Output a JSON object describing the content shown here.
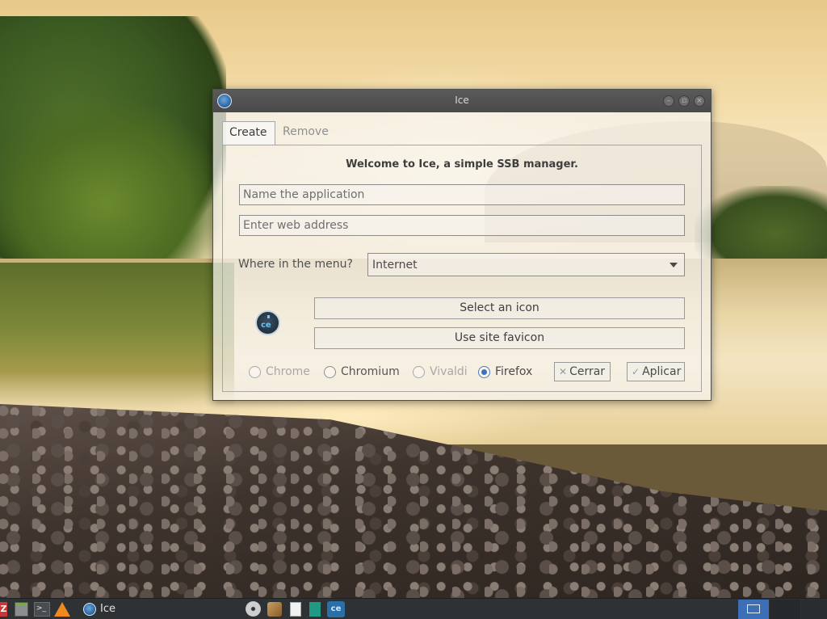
{
  "window": {
    "title": "Ice",
    "tabs": [
      {
        "label": "Create",
        "active": true
      },
      {
        "label": "Remove",
        "active": false
      }
    ],
    "welcome": "Welcome to Ice, a simple SSB manager.",
    "name_field": {
      "value": "",
      "placeholder": "Name the application"
    },
    "url_field": {
      "value": "",
      "placeholder": "Enter web address"
    },
    "menu_label": "Where in the menu?",
    "menu_select": {
      "selected": "Internet"
    },
    "icon_buttons": {
      "select_icon": "Select an icon",
      "favicon": "Use site favicon"
    },
    "browsers": [
      {
        "label": "Chrome",
        "checked": false,
        "enabled": false
      },
      {
        "label": "Chromium",
        "checked": false,
        "enabled": true
      },
      {
        "label": "Vivaldi",
        "checked": false,
        "enabled": false
      },
      {
        "label": "Firefox",
        "checked": true,
        "enabled": true
      }
    ],
    "buttons": {
      "close": "Cerrar",
      "apply": "Aplicar"
    },
    "logo_text": "ce"
  },
  "taskbar": {
    "zotero_glyph": "Z",
    "terminal_glyph": ">_",
    "active_window_label": "Ice",
    "ice_launcher_glyph": "ce",
    "colors": {
      "background": "#2f3234",
      "workspace_active": "#3c6fb8"
    },
    "icons": [
      "zotero-icon",
      "files-icon",
      "terminal-icon",
      "vlc-icon",
      "ice-icon",
      "film-reel-icon",
      "paint-brush-icon",
      "document-icon",
      "book-icon",
      "ice-launcher-icon"
    ]
  },
  "colors": {
    "accent_radio": "#3f72b8",
    "titlebar": "#4a4a4a"
  }
}
